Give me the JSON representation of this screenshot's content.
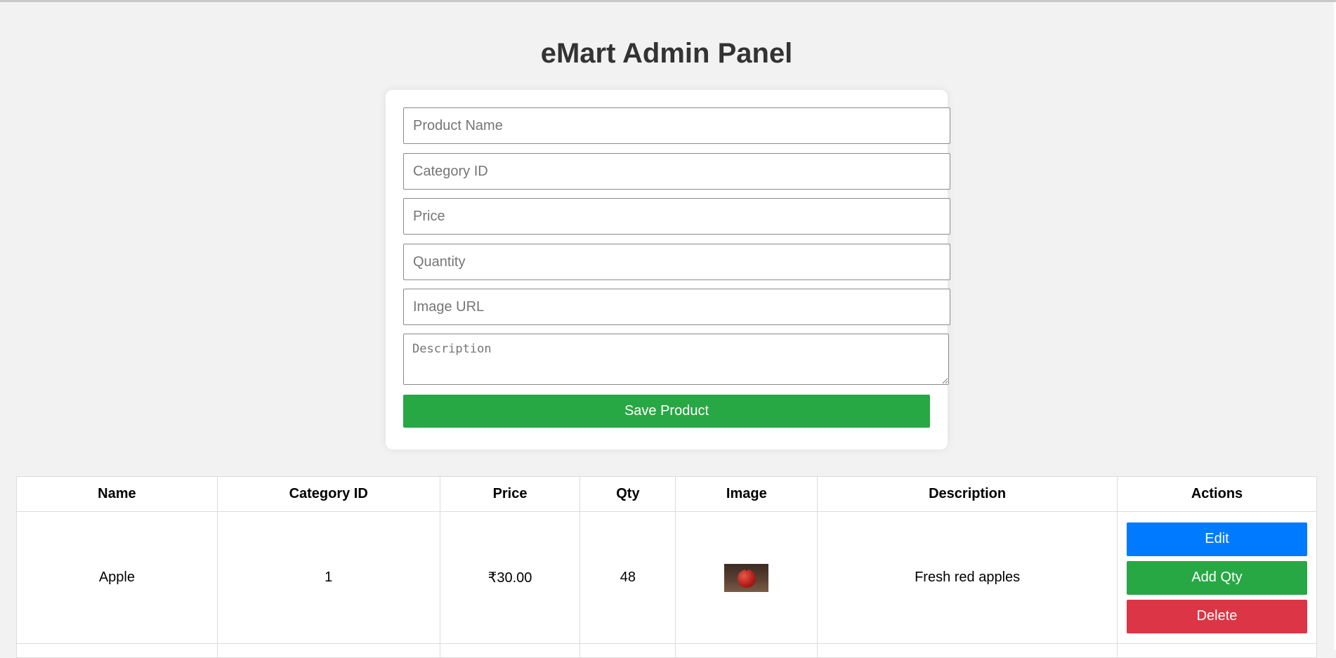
{
  "header": {
    "title": "eMart Admin Panel"
  },
  "form": {
    "name_placeholder": "Product Name",
    "category_placeholder": "Category ID",
    "price_placeholder": "Price",
    "quantity_placeholder": "Quantity",
    "image_placeholder": "Image URL",
    "description_placeholder": "Description",
    "save_label": "Save Product"
  },
  "table": {
    "columns": [
      "Name",
      "Category ID",
      "Price",
      "Qty",
      "Image",
      "Description",
      "Actions"
    ],
    "rows": [
      {
        "name": "Apple",
        "category_id": "1",
        "price": "₹30.00",
        "qty": "48",
        "image_icon": "apple-thumbnail",
        "description": "Fresh red apples",
        "actions": {
          "edit": "Edit",
          "add_qty": "Add Qty",
          "delete": "Delete"
        }
      }
    ]
  },
  "colors": {
    "edit": "#007bff",
    "add_qty": "#28a745",
    "delete": "#dc3545",
    "save": "#28a745"
  }
}
